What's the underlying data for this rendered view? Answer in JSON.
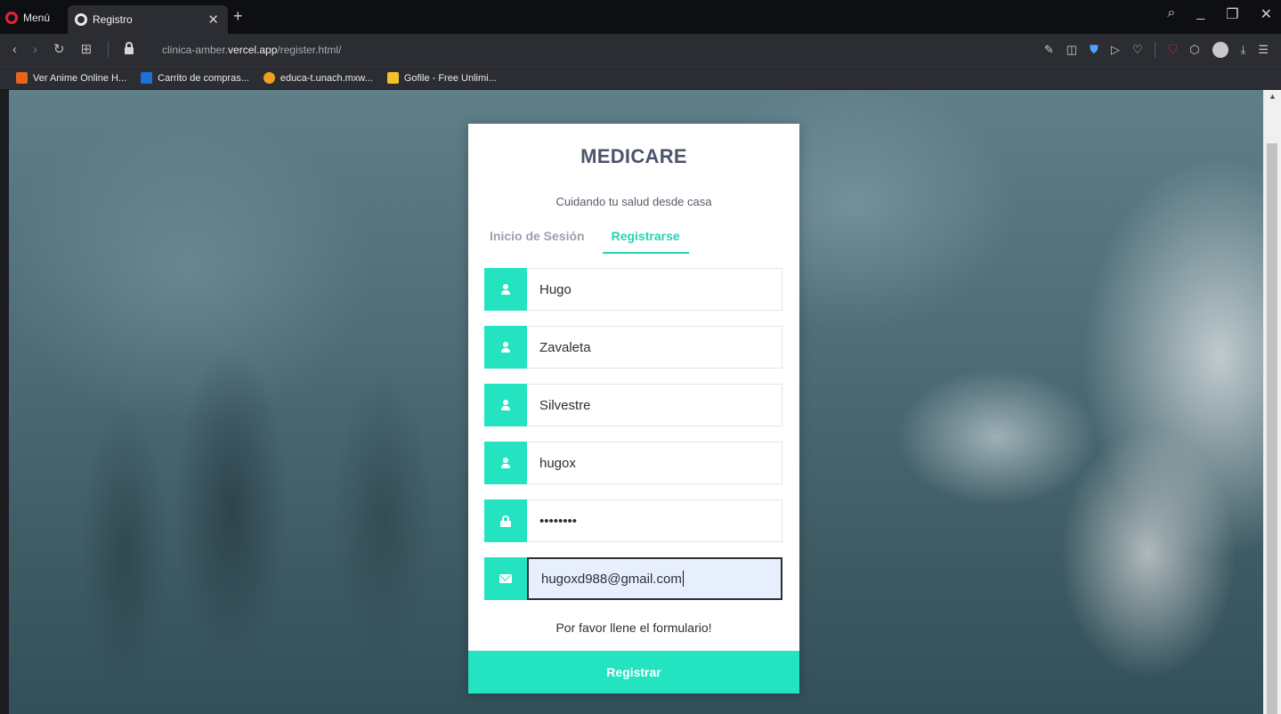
{
  "browser": {
    "menu_label": "Menú",
    "tab_title": "Registro",
    "tab_close": "✕",
    "new_tab": "+",
    "url_prefix": "clinica-amber.",
    "url_domain": "vercel.app",
    "url_path": "/register.html/",
    "bookmarks": [
      {
        "label": "Ver Anime Online H...",
        "icon": "af-icon",
        "color": "#e8641b"
      },
      {
        "label": "Carrito de compras...",
        "icon": "cart-icon",
        "color": "#1e6fd8"
      },
      {
        "label": "educa-t.unach.mxw...",
        "icon": "cap-icon",
        "color": "#f0a020"
      },
      {
        "label": "Gofile - Free Unlimi...",
        "icon": "folder-icon",
        "color": "#f5c02a"
      }
    ]
  },
  "page": {
    "brand": "MEDICARE",
    "tagline": "Cuidando tu salud desde casa",
    "tabs": [
      {
        "label": "Inicio de Sesión",
        "active": false
      },
      {
        "label": "Registrarse",
        "active": true
      }
    ],
    "fields": {
      "first_name": "Hugo",
      "last_name_1": "Zavaleta",
      "last_name_2": "Silvestre",
      "username": "hugox",
      "password": "••••••••",
      "email": "hugoxd988@gmail.com"
    },
    "message": "Por favor llene el formulario!",
    "submit_label": "Registrar"
  },
  "colors": {
    "accent": "#23e3c1",
    "brand_text": "#4b5468",
    "tab_active": "#2bd0b5"
  }
}
